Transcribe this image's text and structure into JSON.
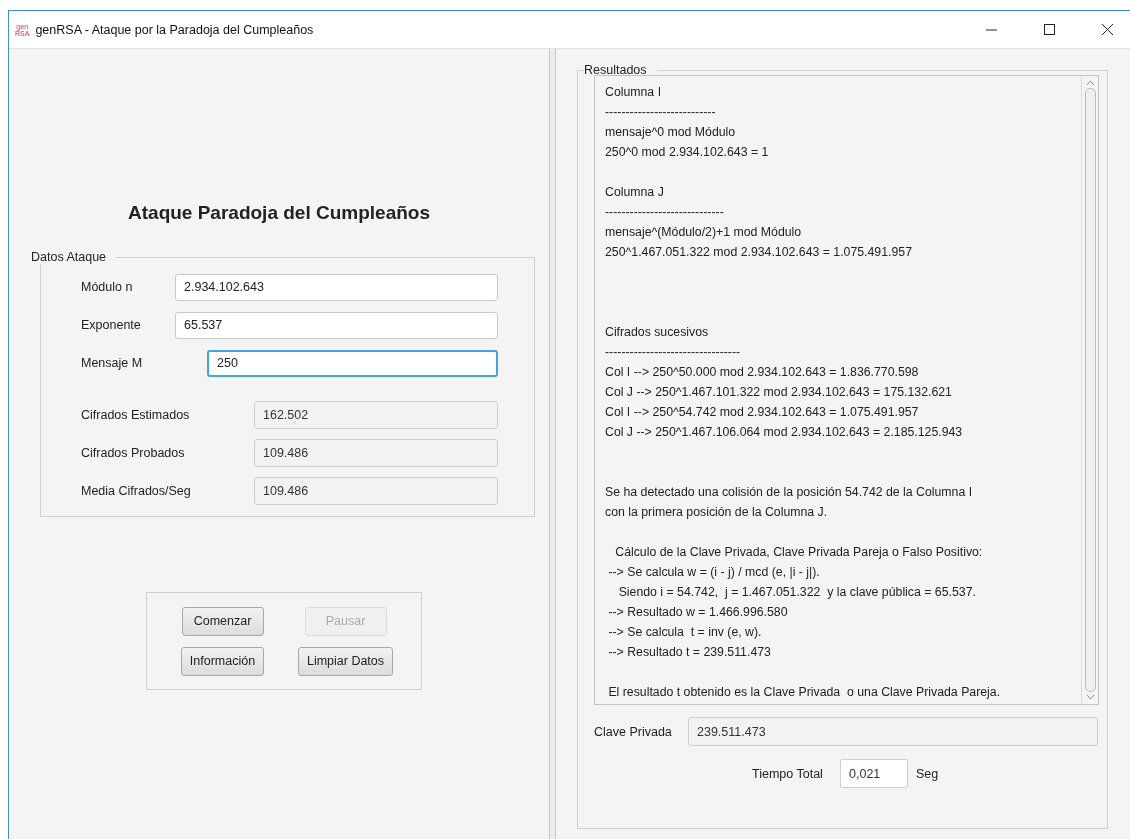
{
  "window": {
    "logo_lines": [
      "gen",
      "RSA"
    ],
    "title": "genRSA - Ataque por la Paradoja del Cumpleaños"
  },
  "left": {
    "heading": "Ataque Paradoja del Cumpleaños",
    "datos": {
      "legend": "Datos Ataque",
      "inputs": [
        {
          "label": "Módulo n",
          "value": "2.934.102.643",
          "focused": false
        },
        {
          "label": "Exponente",
          "value": "65.537",
          "focused": false
        },
        {
          "label": "Mensaje M",
          "value": "250",
          "focused": true
        }
      ],
      "outputs": [
        {
          "label": "Cifrados Estimados",
          "value": "162.502"
        },
        {
          "label": "Cifrados Probados",
          "value": "109.486"
        },
        {
          "label": "Media Cifrados/Seg",
          "value": "109.486"
        }
      ]
    },
    "buttons": [
      {
        "label": "Comenzar",
        "disabled": false
      },
      {
        "label": "Pausar",
        "disabled": true
      },
      {
        "label": "Información",
        "disabled": false
      },
      {
        "label": "Limpiar Datos",
        "disabled": false
      }
    ]
  },
  "right": {
    "legend": "Resultados",
    "log": [
      {
        "lines": [
          "Columna I",
          "---------------------------",
          "mensaje^0 mod Módulo",
          "250^0 mod 2.934.102.643 = 1"
        ]
      },
      {
        "lines": [
          "Columna J",
          "-----------------------------",
          "mensaje^(Módulo/2)+1 mod Módulo",
          "250^1.467.051.322 mod 2.934.102.643 = 1.075.491.957"
        ]
      },
      {
        "lines": [
          "Cifrados sucesivos",
          "---------------------------------",
          "Col I --> 250^50.000 mod 2.934.102.643 = 1.836.770.598",
          "Col J --> 250^1.467.101.322 mod 2.934.102.643 = 175.132.621",
          "Col I --> 250^54.742 mod 2.934.102.643 = 1.075.491.957",
          "Col J --> 250^1.467.106.064 mod 2.934.102.643 = 2.185.125.943"
        ]
      },
      {
        "lines": [
          "Se ha detectado una colisión de la posición 54.742 de la Columna I",
          "con la primera posición de la Columna J."
        ]
      },
      {
        "lines": [
          "   Cálculo de la Clave Privada, Clave Privada Pareja o Falso Positivo:",
          " --> Se calcula w = (i - j) / mcd (e, |i - j|).",
          "    Siendo i = 54.742,  j = 1.467.051.322  y la clave pública = 65.537.",
          " --> Resultado w = 1.466.996.580",
          " --> Se calcula  t = inv (e, w).",
          " --> Resultado t = 239.511.473"
        ]
      },
      {
        "lines": [
          " El resultado t obtenido es la Clave Privada  o una Clave Privada Pareja."
        ]
      }
    ],
    "clave": {
      "label": "Clave Privada",
      "value": "239.511.473"
    },
    "tiempo": {
      "label": "Tiempo Total",
      "value": "0,021",
      "unit": "Seg"
    }
  }
}
